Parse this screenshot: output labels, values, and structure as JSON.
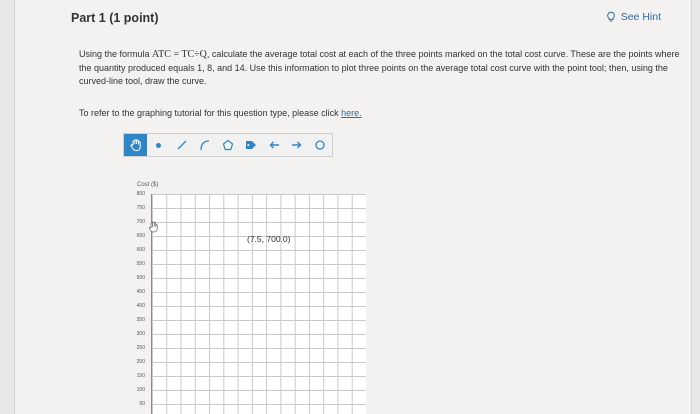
{
  "header": {
    "part_title": "Part 1  (1 point)",
    "hint_label": "See Hint"
  },
  "instructions": {
    "pre_formula": "Using the formula ",
    "formula": "ATC = TC÷Q",
    "post_formula": ", calculate the average total cost at each of the three points marked on the total cost curve. These are the points where the quantity produced equals 1, 8, and 14. Use this information to plot three points on the average total cost curve with the point tool; then, using the curved-line tool, draw the curve."
  },
  "refer": {
    "text": "To refer to the graphing tutorial for this question type, please click ",
    "link": "here."
  },
  "toolbar": {
    "tools": [
      "hand-tool",
      "point-tool",
      "line-tool",
      "curve-tool",
      "polygon-tool",
      "label-tool",
      "undo-tool",
      "redo-tool",
      "reset-tool"
    ]
  },
  "graph": {
    "y_axis_title": "Cost ($)",
    "y_ticks": [
      "800",
      "750",
      "700",
      "650",
      "600",
      "550",
      "500",
      "450",
      "400",
      "350",
      "300",
      "250",
      "200",
      "150",
      "100",
      "50"
    ],
    "point_label": "(7.5, 700.0)",
    "point": {
      "x": 7.5,
      "y": 700.0
    }
  }
}
